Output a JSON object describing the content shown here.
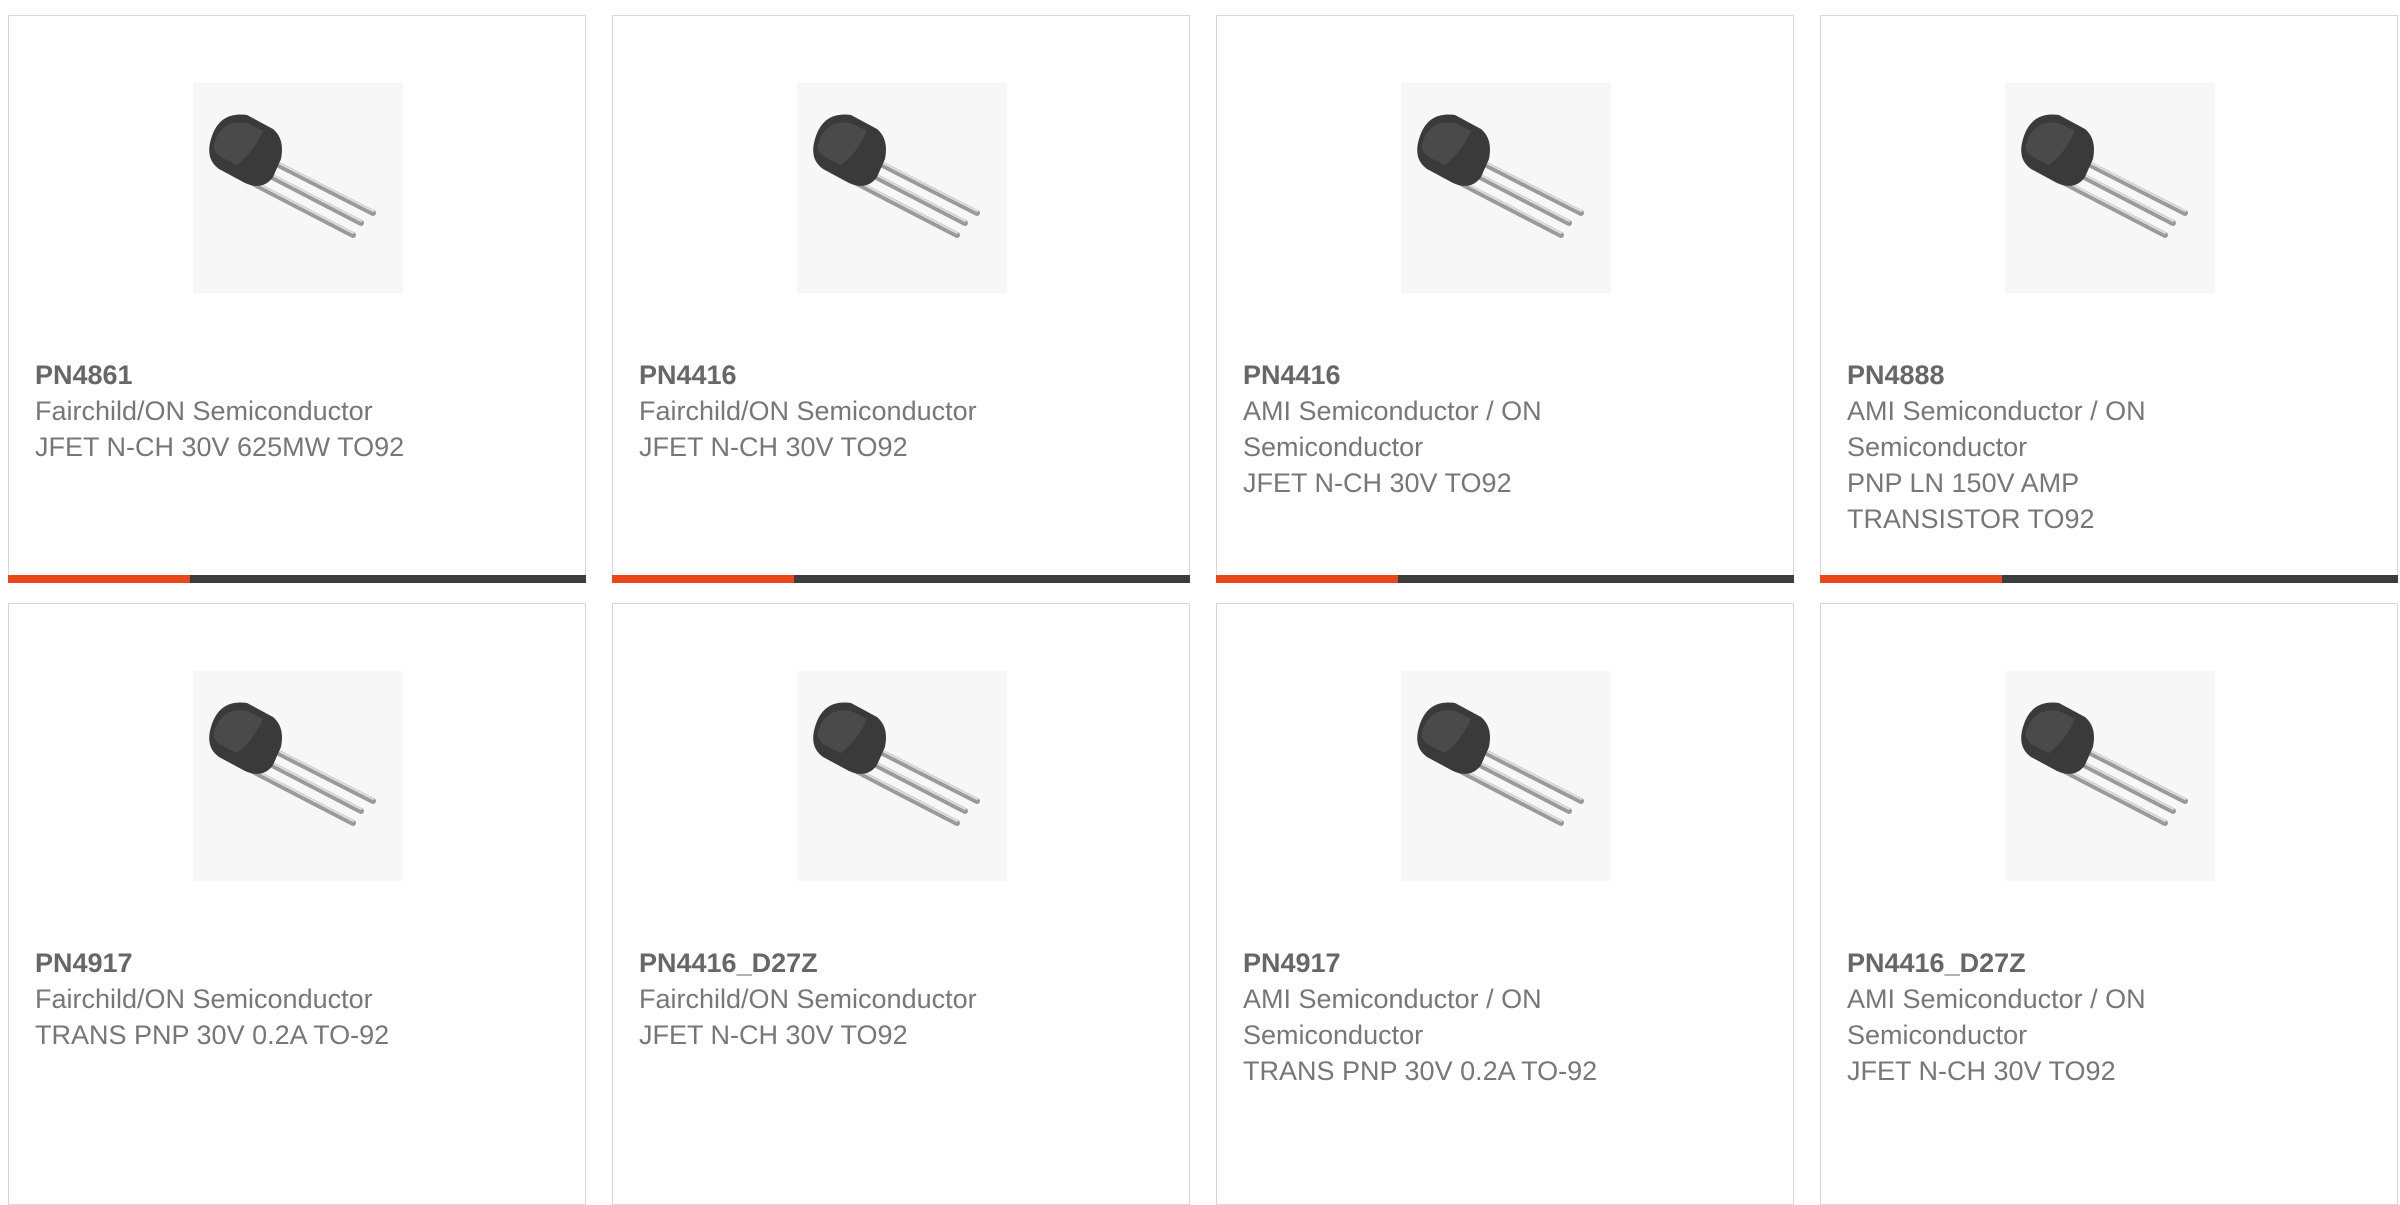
{
  "products": [
    {
      "part": "PN4861",
      "manufacturer": "Fairchild/ON Semiconductor",
      "description": "JFET N-CH 30V 625MW TO92",
      "image_icon": "to92-transistor-icon"
    },
    {
      "part": "PN4416",
      "manufacturer": "Fairchild/ON Semiconductor",
      "description": "JFET N-CH 30V TO92",
      "image_icon": "to92-transistor-icon"
    },
    {
      "part": "PN4416",
      "manufacturer": "AMI Semiconductor / ON\nSemiconductor",
      "description": "JFET N-CH 30V TO92",
      "image_icon": "to92-transistor-icon"
    },
    {
      "part": "PN4888",
      "manufacturer": "AMI Semiconductor / ON\nSemiconductor",
      "description": "PNP LN 150V AMP\nTRANSISTOR TO92",
      "image_icon": "to92-transistor-icon"
    },
    {
      "part": "PN4917",
      "manufacturer": "Fairchild/ON Semiconductor",
      "description": "TRANS PNP 30V 0.2A TO-92",
      "image_icon": "to92-transistor-icon"
    },
    {
      "part": "PN4416_D27Z",
      "manufacturer": "Fairchild/ON Semiconductor",
      "description": "JFET N-CH 30V TO92",
      "image_icon": "to92-transistor-icon"
    },
    {
      "part": "PN4917",
      "manufacturer": "AMI Semiconductor / ON\nSemiconductor",
      "description": "TRANS PNP 30V 0.2A TO-92",
      "image_icon": "to92-transistor-icon"
    },
    {
      "part": "PN4416_D27Z",
      "manufacturer": "AMI Semiconductor / ON\nSemiconductor",
      "description": "JFET N-CH 30V TO92",
      "image_icon": "to92-transistor-icon"
    }
  ],
  "colors": {
    "accent": "#e8471c",
    "bar": "#3d3d3d",
    "border": "#d8d8d8"
  }
}
